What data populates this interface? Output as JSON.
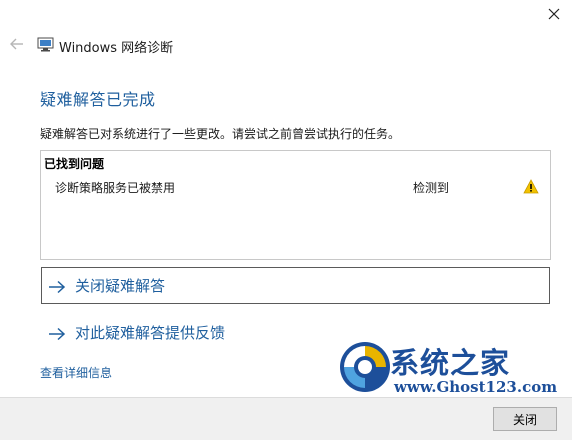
{
  "window": {
    "title": "Windows 网络诊断"
  },
  "heading": "疑难解答已完成",
  "description": "疑难解答已对系统进行了一些更改。请尝试之前曾尝试执行的任务。",
  "issues": {
    "header": "已找到问题",
    "items": [
      {
        "name": "诊断策略服务已被禁用",
        "status": "检测到",
        "icon": "warning-icon"
      }
    ]
  },
  "actions": {
    "close_troubleshooter": "关闭疑难解答",
    "feedback": "对此疑难解答提供反馈"
  },
  "details_link": "查看详细信息",
  "watermark": {
    "cn": "系统之家",
    "url": "www.Ghost123.com"
  },
  "footer": {
    "close_button": "关闭"
  },
  "colors": {
    "accent": "#1f5f9e",
    "warning": "#f2c200",
    "footer_bg": "#f0f0f0"
  }
}
